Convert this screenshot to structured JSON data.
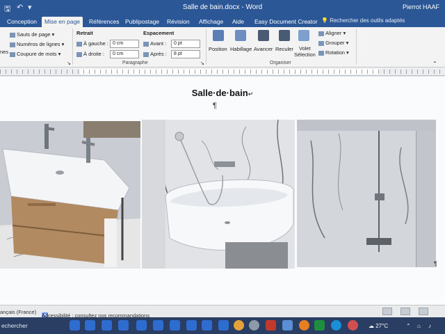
{
  "titlebar": {
    "document_name": "Salle de bain.docx",
    "separator": " - ",
    "app_name": "Word",
    "user_name": "Pierrot HAAF"
  },
  "ribbon": {
    "tabs": [
      "Conception",
      "Mise en page",
      "Références",
      "Publipostage",
      "Révision",
      "Affichage",
      "Aide",
      "Easy Document Creator"
    ],
    "active_tab": "Mise en page",
    "search_placeholder": "Rechercher des outils adaptés",
    "mise_en_page": {
      "sauts_de_page": "Sauts de page",
      "numeros_de_lignes": "Numéros de lignes",
      "coupure_de_mots": "Coupure de mots",
      "cut_label": "nes"
    },
    "retrait": {
      "title": "Retrait",
      "gauche_label": "À gauche :",
      "gauche_value": "0 cm",
      "droite_label": "À droite :",
      "droite_value": "0 cm"
    },
    "espacement": {
      "title": "Espacement",
      "avant_label": "Avant :",
      "avant_value": "0 pt",
      "apres_label": "Après :",
      "apres_value": "8 pt"
    },
    "paragraphe_label": "Paragraphe",
    "organiser": {
      "position": "Position",
      "habillage": "Habillage",
      "avancer": "Avancer",
      "reculer": "Reculer",
      "volet_line1": "Volet",
      "volet_line2": "Sélection",
      "aligner": "Aligner",
      "grouper": "Grouper",
      "rotation": "Rotation",
      "label": "Organiser"
    }
  },
  "document": {
    "heading": "Salle·de·bain",
    "line_break_mark": "↵",
    "paragraph_mark": "¶"
  },
  "statusbar": {
    "language": "ançais (France)",
    "accessibility": "Accessibilité : consultez nos recommandations"
  },
  "taskbar": {
    "search_label": "echercher",
    "weather": "27°C"
  },
  "colors": {
    "accent": "#2b5797",
    "taskbar": "#2a3d62"
  }
}
